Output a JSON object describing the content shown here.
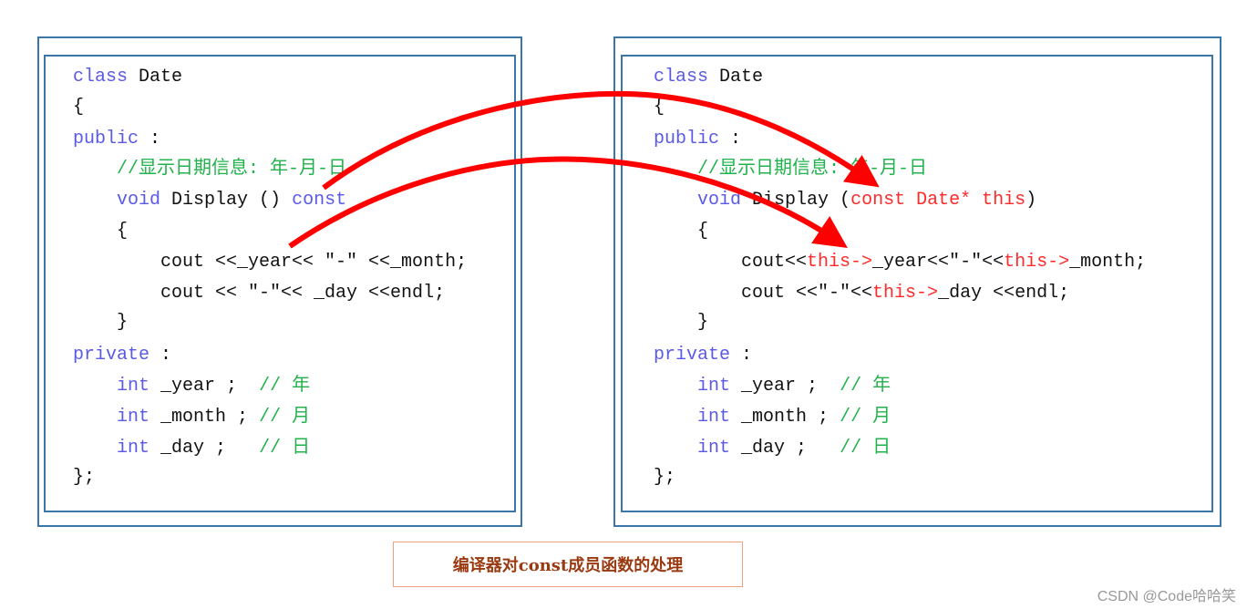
{
  "colors": {
    "keyword": "#5a5ae6",
    "comment": "#22b24c",
    "highlight": "#ff2a2a",
    "arrow": "#ff0000",
    "border": "#3a77a8"
  },
  "left_code": [
    [
      {
        "t": "class",
        "c": "kw"
      },
      {
        "t": " Date",
        "c": "tx"
      }
    ],
    [
      {
        "t": "{",
        "c": "tx"
      }
    ],
    [
      {
        "t": "public",
        "c": "kw"
      },
      {
        "t": " :",
        "c": "tx"
      }
    ],
    [
      {
        "t": "    //显示日期信息: 年-月-日",
        "c": "cm"
      }
    ],
    [
      {
        "t": "    ",
        "c": "tx"
      },
      {
        "t": "void",
        "c": "kw"
      },
      {
        "t": " Display () ",
        "c": "tx"
      },
      {
        "t": "const",
        "c": "kw"
      }
    ],
    [
      {
        "t": "    {",
        "c": "tx"
      }
    ],
    [
      {
        "t": "        cout <<_year<< \"-\" <<_month;",
        "c": "tx"
      }
    ],
    [
      {
        "t": "        cout << \"-\"<< _day <<endl;",
        "c": "tx"
      }
    ],
    [
      {
        "t": "    }",
        "c": "tx"
      }
    ],
    [
      {
        "t": "private",
        "c": "kw"
      },
      {
        "t": " :",
        "c": "tx"
      }
    ],
    [
      {
        "t": "    ",
        "c": "tx"
      },
      {
        "t": "int",
        "c": "kw"
      },
      {
        "t": " _year ;  ",
        "c": "tx"
      },
      {
        "t": "// 年",
        "c": "cm"
      }
    ],
    [
      {
        "t": "    ",
        "c": "tx"
      },
      {
        "t": "int",
        "c": "kw"
      },
      {
        "t": " _month ; ",
        "c": "tx"
      },
      {
        "t": "// 月",
        "c": "cm"
      }
    ],
    [
      {
        "t": "    ",
        "c": "tx"
      },
      {
        "t": "int",
        "c": "kw"
      },
      {
        "t": " _day ;   ",
        "c": "tx"
      },
      {
        "t": "// 日",
        "c": "cm"
      }
    ],
    [
      {
        "t": "};",
        "c": "tx"
      }
    ]
  ],
  "right_code": [
    [
      {
        "t": "class",
        "c": "kw"
      },
      {
        "t": " Date",
        "c": "tx"
      }
    ],
    [
      {
        "t": "{",
        "c": "tx"
      }
    ],
    [
      {
        "t": "public",
        "c": "kw"
      },
      {
        "t": " :",
        "c": "tx"
      }
    ],
    [
      {
        "t": "    //显示日期信息: 年-月-日",
        "c": "cm"
      }
    ],
    [
      {
        "t": "    ",
        "c": "tx"
      },
      {
        "t": "void",
        "c": "kw"
      },
      {
        "t": " Display (",
        "c": "tx"
      },
      {
        "t": "const Date* this",
        "c": "rd"
      },
      {
        "t": ")",
        "c": "tx"
      }
    ],
    [
      {
        "t": "    {",
        "c": "tx"
      }
    ],
    [
      {
        "t": "        cout<<",
        "c": "tx"
      },
      {
        "t": "this->",
        "c": "rd"
      },
      {
        "t": "_year<<\"-\"<<",
        "c": "tx"
      },
      {
        "t": "this->",
        "c": "rd"
      },
      {
        "t": "_month;",
        "c": "tx"
      }
    ],
    [
      {
        "t": "        cout <<\"-\"<<",
        "c": "tx"
      },
      {
        "t": "this->",
        "c": "rd"
      },
      {
        "t": "_day <<endl;",
        "c": "tx"
      }
    ],
    [
      {
        "t": "    }",
        "c": "tx"
      }
    ],
    [
      {
        "t": "private",
        "c": "kw"
      },
      {
        "t": " :",
        "c": "tx"
      }
    ],
    [
      {
        "t": "    ",
        "c": "tx"
      },
      {
        "t": "int",
        "c": "kw"
      },
      {
        "t": " _year ;  ",
        "c": "tx"
      },
      {
        "t": "// 年",
        "c": "cm"
      }
    ],
    [
      {
        "t": "    ",
        "c": "tx"
      },
      {
        "t": "int",
        "c": "kw"
      },
      {
        "t": " _month ; ",
        "c": "tx"
      },
      {
        "t": "// 月",
        "c": "cm"
      }
    ],
    [
      {
        "t": "    ",
        "c": "tx"
      },
      {
        "t": "int",
        "c": "kw"
      },
      {
        "t": " _day ;   ",
        "c": "tx"
      },
      {
        "t": "// 日",
        "c": "cm"
      }
    ],
    [
      {
        "t": "};",
        "c": "tx"
      }
    ]
  ],
  "caption": "编译器对const成员函数的处理",
  "watermark": "CSDN @Code哈哈笑"
}
